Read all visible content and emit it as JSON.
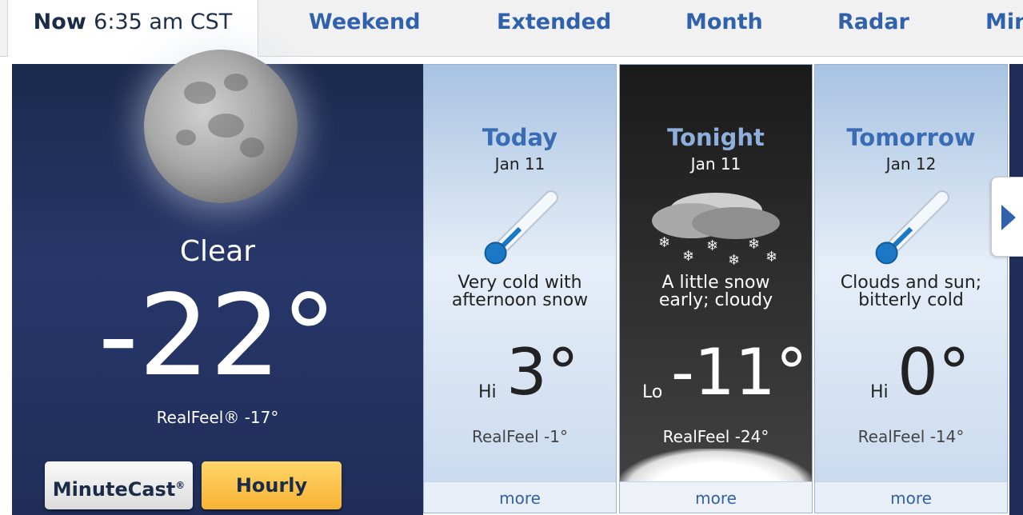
{
  "tabs": {
    "now_label": "Now",
    "now_time": "6:35 am CST",
    "items": [
      "Weekend",
      "Extended",
      "Month",
      "Radar",
      "Min"
    ]
  },
  "current": {
    "condition": "Clear",
    "temp": "-22°",
    "realfeel": "RealFeel® -17°",
    "buttons": {
      "minutecast": "MinuteCast",
      "minutecast_mark": "®",
      "hourly": "Hourly"
    }
  },
  "forecast": [
    {
      "title": "Today",
      "date": "Jan 11",
      "desc1": "Very cold with",
      "desc2": "afternoon snow",
      "hilo": "Hi",
      "temp": "3°",
      "realfeel": "RealFeel -1°",
      "more": "more",
      "icon": "thermometer-cold-icon"
    },
    {
      "title": "Tonight",
      "date": "Jan 11",
      "desc1": "A little snow",
      "desc2": "early; cloudy",
      "hilo": "Lo",
      "temp": "-11°",
      "realfeel": "RealFeel -24°",
      "more": "more",
      "icon": "cloud-snow-icon"
    },
    {
      "title": "Tomorrow",
      "date": "Jan 12",
      "desc1": "Clouds and sun;",
      "desc2": "bitterly cold",
      "hilo": "Hi",
      "temp": "0°",
      "realfeel": "RealFeel -14°",
      "more": "more",
      "icon": "thermometer-cold-icon"
    }
  ],
  "colors": {
    "accent": "#2f61ad",
    "hourly_button": "#f7b234",
    "night_bg": "#1f2d58"
  }
}
